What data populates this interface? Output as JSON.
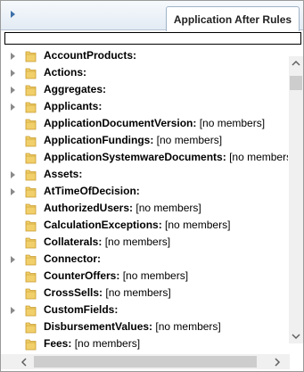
{
  "header": {
    "tab_label": "Application After Rules"
  },
  "search": {
    "value": "",
    "placeholder": ""
  },
  "colors": {
    "accent": "#3b6fa8",
    "folder_fill": "#f1cf6a",
    "folder_edge": "#c89b2c"
  },
  "icons": {
    "folder": "folder-icon",
    "expander": "expand-arrow-icon"
  },
  "tree": {
    "items": [
      {
        "name": "AccountProducts:",
        "suffix": "",
        "expandable": true
      },
      {
        "name": "Actions:",
        "suffix": "",
        "expandable": true
      },
      {
        "name": "Aggregates:",
        "suffix": "",
        "expandable": true
      },
      {
        "name": "Applicants:",
        "suffix": "",
        "expandable": true
      },
      {
        "name": "ApplicationDocumentVersion:",
        "suffix": "[no members]",
        "expandable": false
      },
      {
        "name": "ApplicationFundings:",
        "suffix": "[no members]",
        "expandable": false
      },
      {
        "name": "ApplicationSystemwareDocuments:",
        "suffix": "[no members]",
        "expandable": false
      },
      {
        "name": "Assets:",
        "suffix": "",
        "expandable": true
      },
      {
        "name": "AtTimeOfDecision:",
        "suffix": "",
        "expandable": true
      },
      {
        "name": "AuthorizedUsers:",
        "suffix": "[no members]",
        "expandable": false
      },
      {
        "name": "CalculationExceptions:",
        "suffix": "[no members]",
        "expandable": false
      },
      {
        "name": "Collaterals:",
        "suffix": "[no members]",
        "expandable": false
      },
      {
        "name": "Connector:",
        "suffix": "",
        "expandable": true
      },
      {
        "name": "CounterOffers:",
        "suffix": "[no members]",
        "expandable": false
      },
      {
        "name": "CrossSells:",
        "suffix": "[no members]",
        "expandable": false
      },
      {
        "name": "CustomFields:",
        "suffix": "",
        "expandable": true
      },
      {
        "name": "DisbursementValues:",
        "suffix": "[no members]",
        "expandable": false
      },
      {
        "name": "Fees:",
        "suffix": "[no members]",
        "expandable": false
      }
    ]
  }
}
